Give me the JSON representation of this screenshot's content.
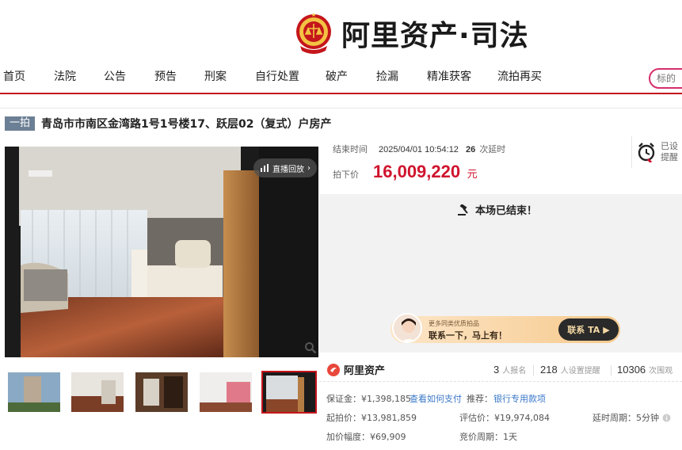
{
  "brand": {
    "name": "阿里资产·司法"
  },
  "nav": {
    "items": [
      "首页",
      "法院",
      "公告",
      "预告",
      "刑案",
      "自行处置",
      "破产",
      "捡漏",
      "精准获客",
      "流拍再买"
    ],
    "search_placeholder": "标的"
  },
  "auction": {
    "badge": "一拍",
    "title": "青岛市市南区金湾路1号1号楼17、跃层02（复式）户房产",
    "replay_label": "直播回放",
    "end_time_label": "结束时间",
    "end_time": "2025/04/01 10:54:12",
    "delay_count": "26",
    "delay_label": "次延时",
    "hammer_label": "拍下价",
    "hammer_price": "16,009,220",
    "currency_unit": "元",
    "remind_text_1": "已设",
    "remind_text_2": "提醒",
    "ended_text": "本场已结束！"
  },
  "banner": {
    "small": "更多同类优质拍品",
    "big": "联系一下，马上有！",
    "button": "联系 TA"
  },
  "stats": {
    "ali_label": "阿里资产",
    "signups": "3",
    "signups_label": "人报名",
    "reminders": "218",
    "reminders_label": "人设置提醒",
    "views": "10306",
    "views_label": "次围观"
  },
  "details": {
    "deposit": "保证金：¥1,398,185",
    "deposit_link": "查看如何支付",
    "recommend_label": "推荐：",
    "recommend_link": "银行专用款项",
    "start_price": "起拍价：¥13,981,859",
    "appraisal": "评估价：¥19,974,084",
    "delay_period": "延时周期：5分钟",
    "increment": "加价幅度：¥69,909",
    "bid_cycle": "竞价周期：1天"
  },
  "colors": {
    "accent": "#c4161c",
    "price": "#d0142e",
    "link": "#3a78c8"
  },
  "icons": [
    "court-emblem-icon",
    "replay-icon",
    "zoom-icon",
    "alarm-clock-icon",
    "gavel-icon",
    "alibaba-logo-icon",
    "info-icon"
  ]
}
